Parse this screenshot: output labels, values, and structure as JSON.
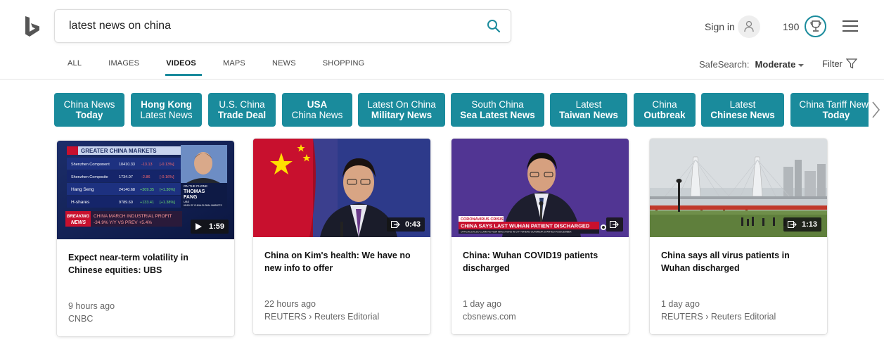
{
  "search": {
    "query": "latest news on china"
  },
  "header": {
    "signin_label": "Sign in",
    "points": "190"
  },
  "tabs": [
    {
      "label": "ALL",
      "active": false
    },
    {
      "label": "IMAGES",
      "active": false
    },
    {
      "label": "VIDEOS",
      "active": true
    },
    {
      "label": "MAPS",
      "active": false
    },
    {
      "label": "NEWS",
      "active": false
    },
    {
      "label": "SHOPPING",
      "active": false
    }
  ],
  "safesearch": {
    "label": "SafeSearch:",
    "value": "Moderate"
  },
  "filter": {
    "label": "Filter"
  },
  "chips": [
    {
      "line1": "China News",
      "line2": "Today"
    },
    {
      "line1": "Hong Kong",
      "line2": "Latest News"
    },
    {
      "line1": "U.S. China",
      "line2": "Trade Deal"
    },
    {
      "line1": "USA",
      "line2": "China News"
    },
    {
      "line1": "Latest On China",
      "line2": "Military News"
    },
    {
      "line1": "South China",
      "line2": "Sea Latest News"
    },
    {
      "line1": "Latest",
      "line2": "Taiwan News"
    },
    {
      "line1": "China",
      "line2": "Outbreak"
    },
    {
      "line1": "Latest",
      "line2": "Chinese News"
    },
    {
      "line1": "China Tariff News",
      "line2": "Today"
    }
  ],
  "cards": [
    {
      "title": "Expect near-term volatility in Chinese equities: UBS",
      "age": "9 hours ago",
      "source": "CNBC",
      "duration": "1:59",
      "thumb": {
        "banner": "GREATER CHINA MARKETS",
        "rows": [
          {
            "name": "Shenzhen Component",
            "value": "10410.33",
            "chg": "-13.13",
            "pct": "[-0.13%]"
          },
          {
            "name": "Shenzhen Composite",
            "value": "1734.07",
            "chg": "-2.86",
            "pct": "[-0.16%]"
          },
          {
            "name": "Hang Seng",
            "value": "24140.68",
            "chg": "+309.35",
            "pct": "[+1.30%]"
          },
          {
            "name": "H-shares",
            "value": "9789.60",
            "chg": "+133.41",
            "pct": "[+1.38%]"
          }
        ],
        "phone_label": "ON THE PHONE",
        "guest_name_1": "THOMAS",
        "guest_name_2": "FANG",
        "guest_org": "UBS",
        "guest_role": "HEAD OF CHINA GLOBAL MARKETS",
        "breaking_1": "BREAKING",
        "breaking_2": "NEWS",
        "ticker_1": "CHINA MARCH INDUSTRIAL PROFIT",
        "ticker_2": "-34.9% Y/Y VS PREV +5.4%"
      }
    },
    {
      "title": "China on Kim's health: We have no new info to offer",
      "age": "22 hours ago",
      "source": "REUTERS › Reuters Editorial",
      "duration": "0:43"
    },
    {
      "title": "China: Wuhan COVID19 patients discharged",
      "age": "1 day ago",
      "source": "cbsnews.com",
      "duration": "",
      "thumb": {
        "lower_tag": "CORONAVIRUS CRISIS",
        "lower_text": "CHINA SAYS LAST WUHAN PATIENT DISCHARGED",
        "lower_sub": "OFFICIALS ALSO CLAIM NO NEW INFECTIONS IN CITY WHERE OUTBREAK STARTED IN DECEMBER"
      }
    },
    {
      "title": "China says all virus patients in Wuhan discharged",
      "age": "1 day ago",
      "source": "REUTERS › Reuters Editorial",
      "duration": "1:13"
    }
  ],
  "colors": {
    "accent": "#1a8b9c",
    "red": "#c8102e",
    "purple": "#5a3a9a"
  }
}
